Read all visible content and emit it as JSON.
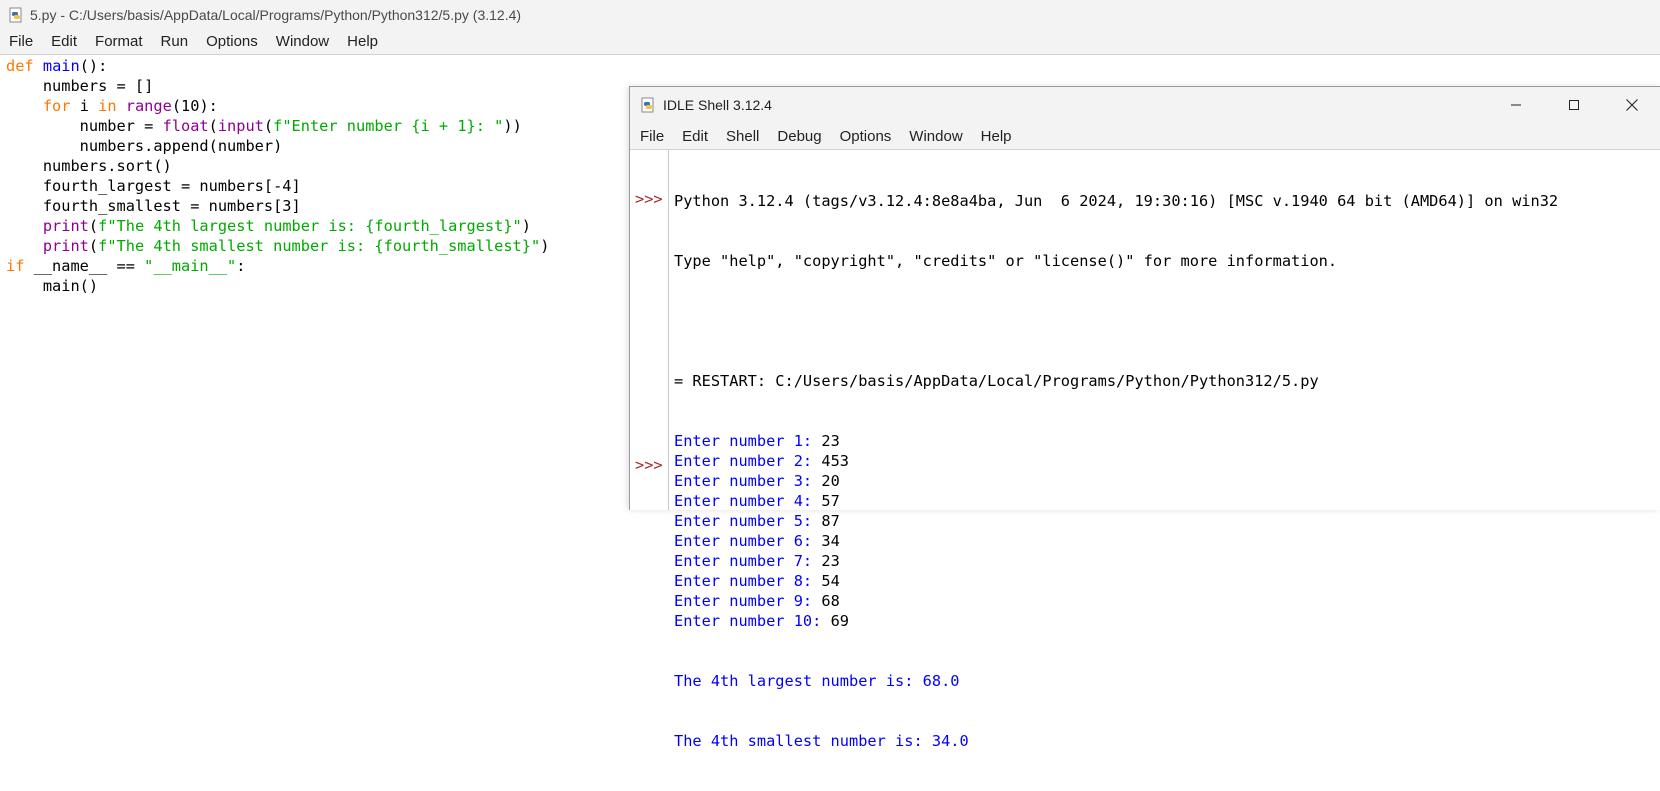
{
  "editor_window": {
    "title": "5.py - C:/Users/basis/AppData/Local/Programs/Python/Python312/5.py (3.12.4)",
    "menu": [
      "File",
      "Edit",
      "Format",
      "Run",
      "Options",
      "Window",
      "Help"
    ],
    "code_lines": [
      "def main():",
      "    numbers = []",
      "    for i in range(10):",
      "        number = float(input(f\"Enter number {i + 1}: \"))",
      "        numbers.append(number)",
      "    numbers.sort()",
      "    fourth_largest = numbers[-4]",
      "    fourth_smallest = numbers[3]",
      "    print(f\"The 4th largest number is: {fourth_largest}\")",
      "    print(f\"The 4th smallest number is: {fourth_smallest}\")",
      "if __name__ == \"__main__\":",
      "    main()"
    ]
  },
  "shell_window": {
    "title": "IDLE Shell 3.12.4",
    "menu": [
      "File",
      "Edit",
      "Shell",
      "Debug",
      "Options",
      "Window",
      "Help"
    ],
    "controls": {
      "minimize": "minimize-icon",
      "maximize": "maximize-icon",
      "close": "close-icon"
    },
    "prompt": ">>>",
    "banner_line1": "Python 3.12.4 (tags/v3.12.4:8e8a4ba, Jun  6 2024, 19:30:16) [MSC v.1940 64 bit (AMD64)] on win32",
    "banner_line2": "Type \"help\", \"copyright\", \"credits\" or \"license()\" for more information.",
    "restart_line": "= RESTART: C:/Users/basis/AppData/Local/Programs/Python/Python312/5.py",
    "inputs": [
      {
        "prompt": "Enter number 1: ",
        "value": "23"
      },
      {
        "prompt": "Enter number 2: ",
        "value": "453"
      },
      {
        "prompt": "Enter number 3: ",
        "value": "20"
      },
      {
        "prompt": "Enter number 4: ",
        "value": "57"
      },
      {
        "prompt": "Enter number 5: ",
        "value": "87"
      },
      {
        "prompt": "Enter number 6: ",
        "value": "34"
      },
      {
        "prompt": "Enter number 7: ",
        "value": "23"
      },
      {
        "prompt": "Enter number 8: ",
        "value": "54"
      },
      {
        "prompt": "Enter number 9: ",
        "value": "68"
      },
      {
        "prompt": "Enter number 10: ",
        "value": "69"
      }
    ],
    "result_largest": "The 4th largest number is: 68.0",
    "result_smallest": "The 4th smallest number is: 34.0"
  },
  "colors": {
    "keyword": "#ff7700",
    "builtin": "#900090",
    "string": "#00aa00",
    "definition": "#0000ff",
    "stdout": "#0000ff",
    "prompt": "#a52a2a"
  }
}
